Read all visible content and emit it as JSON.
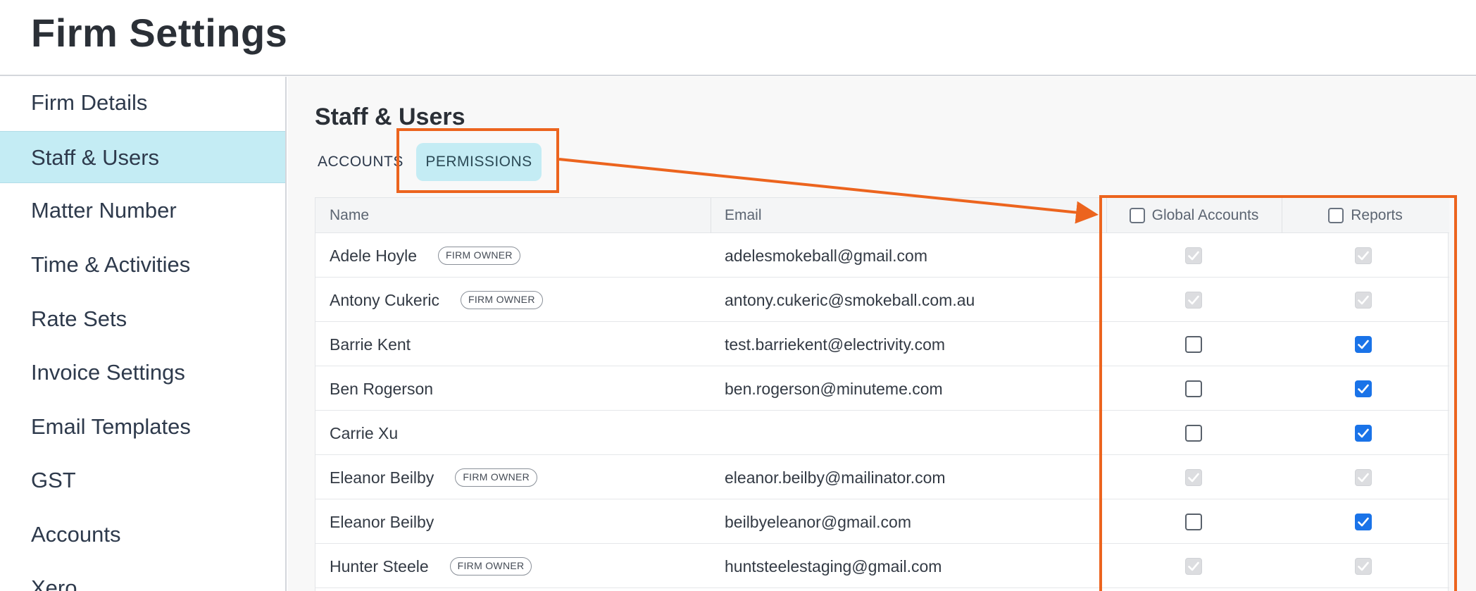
{
  "header": {
    "title": "Firm Settings"
  },
  "sidebar": {
    "items": [
      {
        "label": "Firm Details",
        "active": false
      },
      {
        "label": "Staff & Users",
        "active": true
      },
      {
        "label": "Matter Number",
        "active": false
      },
      {
        "label": "Time & Activities",
        "active": false
      },
      {
        "label": "Rate Sets",
        "active": false
      },
      {
        "label": "Invoice Settings",
        "active": false
      },
      {
        "label": "Email Templates",
        "active": false
      },
      {
        "label": "GST",
        "active": false
      },
      {
        "label": "Accounts",
        "active": false
      },
      {
        "label": "Xero",
        "active": false
      }
    ]
  },
  "main": {
    "section_title": "Staff & Users",
    "tabs": [
      {
        "label": "ACCOUNTS",
        "active": false
      },
      {
        "label": "PERMISSIONS",
        "active": true
      }
    ],
    "table": {
      "columns": {
        "name": "Name",
        "email": "Email",
        "global_accounts": "Global Accounts",
        "reports": "Reports"
      },
      "rows": [
        {
          "name": "Adele Hoyle",
          "badge": "FIRM OWNER",
          "email": "adelesmokeball@gmail.com",
          "global": "disabled",
          "reports": "disabled"
        },
        {
          "name": "Antony Cukeric",
          "badge": "FIRM OWNER",
          "email": "antony.cukeric@smokeball.com.au",
          "global": "disabled",
          "reports": "disabled"
        },
        {
          "name": "Barrie Kent",
          "badge": "",
          "email": "test.barriekent@electrivity.com",
          "global": "off",
          "reports": "on"
        },
        {
          "name": "Ben Rogerson",
          "badge": "",
          "email": "ben.rogerson@minuteme.com",
          "global": "off",
          "reports": "on"
        },
        {
          "name": "Carrie Xu",
          "badge": "",
          "email": "",
          "global": "off",
          "reports": "on"
        },
        {
          "name": "Eleanor Beilby",
          "badge": "FIRM OWNER",
          "email": "eleanor.beilby@mailinator.com",
          "global": "disabled",
          "reports": "disabled"
        },
        {
          "name": "Eleanor Beilby",
          "badge": "",
          "email": "beilbyeleanor@gmail.com",
          "global": "off",
          "reports": "on"
        },
        {
          "name": "Hunter Steele",
          "badge": "FIRM OWNER",
          "email": "huntsteelestaging@gmail.com",
          "global": "disabled",
          "reports": "disabled"
        }
      ]
    }
  },
  "colors": {
    "accent": "#ec641e",
    "active_bg": "#c4ecf4",
    "checkbox_on": "#1a73e8"
  }
}
